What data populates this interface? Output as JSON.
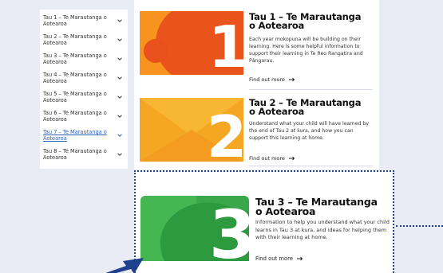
{
  "sidebar": {
    "items": [
      {
        "label": "Tau 1 – Te Marautanga o Aotearoa",
        "active": false
      },
      {
        "label": "Tau 2 – Te Marautanga o Aotearoa",
        "active": false
      },
      {
        "label": "Tau 3 – Te Marautanga o Aotearoa",
        "active": false
      },
      {
        "label": "Tau 4 – Te Marautanga o Aotearoa",
        "active": false
      },
      {
        "label": "Tau 5 – Te Marautanga o Aotearoa",
        "active": false
      },
      {
        "label": "Tau 6 – Te Marautanga o Aotearoa",
        "active": false
      },
      {
        "label": "Tau 7 – Te Marautanga o Aotearoa",
        "active": true
      },
      {
        "label": "Tau 8 – Te Marautanga o Aotearoa",
        "active": false
      }
    ]
  },
  "cards": [
    {
      "number": "1",
      "title": "Tau 1 – Te Marautanga o Aotearoa",
      "description": "Each year mokopuna will be building on their learning. Here is some helpful information to support their learning in Te Reo Rangatira and Pāngarau.",
      "link": "Find out more",
      "color": "#f26a1b"
    },
    {
      "number": "2",
      "title": "Tau 2 – Te Marautanga o Aotearoa",
      "description": "Understand what your child will have learned by the end of Tau 2 at kura, and how you can support this learning at home.",
      "link": "Find out more",
      "color": "#f5a623"
    },
    {
      "number": "3",
      "title": "Tau 3 – Te Marautanga o Aotearoa",
      "description": "Information to help you understand what your child learns in Tau 3 at kura, and ideas for helping them with their learning at home.",
      "link": "Find out more",
      "color": "#3aa84a"
    }
  ],
  "colors": {
    "highlight_border": "#1f3f8f",
    "active_link": "#2f5fb3",
    "background": "#e9ecf4"
  },
  "icons": {
    "chevron": "chevron-down-icon",
    "arrow": "arrow-right-icon"
  }
}
